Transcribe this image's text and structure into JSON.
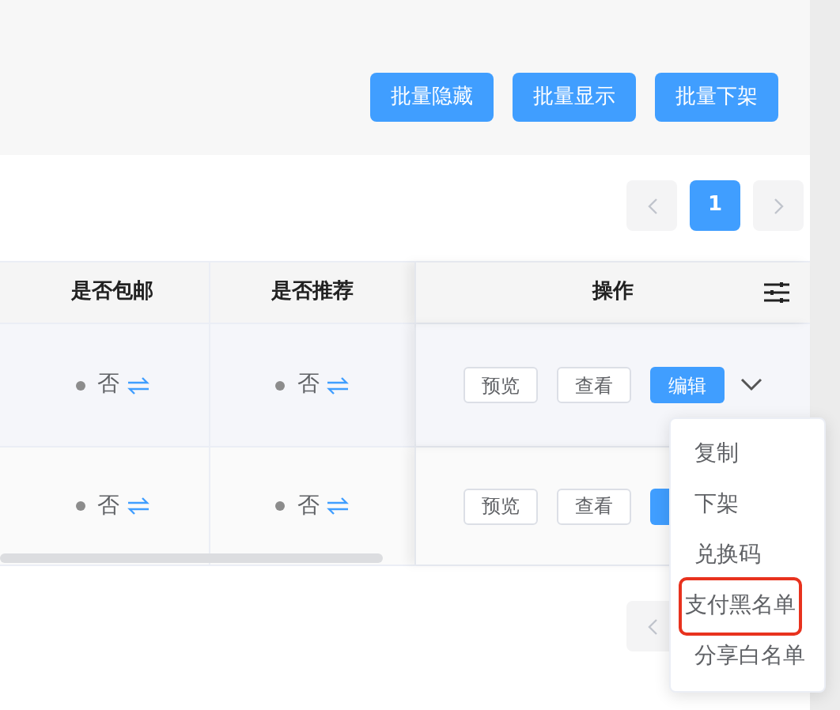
{
  "batch_buttons": [
    "批量隐藏",
    "批量显示",
    "批量下架"
  ],
  "pagination": {
    "pages": [
      {
        "label": "1",
        "selected": true
      }
    ]
  },
  "table": {
    "columns": [
      "是否包邮",
      "是否推荐",
      "操作"
    ],
    "rows": [
      {
        "hovered": true,
        "free_shipping": {
          "text": "否",
          "color": "#8c8c8c"
        },
        "recommended": {
          "text": "否",
          "color": "#8c8c8c"
        },
        "actions": [
          {
            "label": "预览",
            "kind": "plain"
          },
          {
            "label": "查看",
            "kind": "plain"
          },
          {
            "label": "编辑",
            "kind": "primary"
          }
        ],
        "menu": {
          "open": true,
          "items": [
            {
              "label": "复制",
              "highlighted": false
            },
            {
              "label": "下架",
              "highlighted": false
            },
            {
              "label": "兑换码",
              "highlighted": false
            },
            {
              "label": "支付黑名单",
              "highlighted": true
            },
            {
              "label": "分享白名单",
              "highlighted": false
            }
          ]
        }
      },
      {
        "hovered": false,
        "free_shipping": {
          "text": "否",
          "color": "#8c8c8c"
        },
        "recommended": {
          "text": "否",
          "color": "#8c8c8c"
        },
        "actions": [
          {
            "label": "预览",
            "kind": "plain"
          },
          {
            "label": "查看",
            "kind": "plain"
          },
          {
            "kind": "primary"
          }
        ]
      }
    ]
  }
}
